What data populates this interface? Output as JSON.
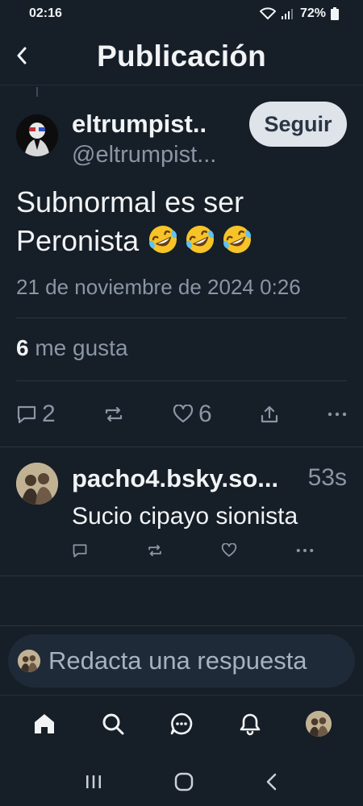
{
  "status_bar": {
    "time": "02:16",
    "battery": "72%"
  },
  "header": {
    "title": "Publicación"
  },
  "post": {
    "author_name": "eltrumpist..",
    "author_handle": "@eltrumpist...",
    "follow_label": "Seguir",
    "text_line1": "Subnormal es ser",
    "text_line2": "Peronista",
    "emojis": [
      "rolling-on-floor-laughing",
      "rolling-on-floor-laughing",
      "rolling-on-floor-laughing"
    ],
    "date": "21 de noviembre de 2024 0:26",
    "likes_count": "6",
    "likes_label": "me gusta",
    "reply_count": "2",
    "like_count": "6"
  },
  "reply": {
    "author_name": "pacho4.bsky.so...",
    "time": "53s",
    "text": "Sucio cipayo sionista"
  },
  "compose": {
    "placeholder": "Redacta una respuesta"
  },
  "colors": {
    "background": "#161e27",
    "muted": "#8a96a5",
    "follow_bg": "#dfe4ea"
  }
}
